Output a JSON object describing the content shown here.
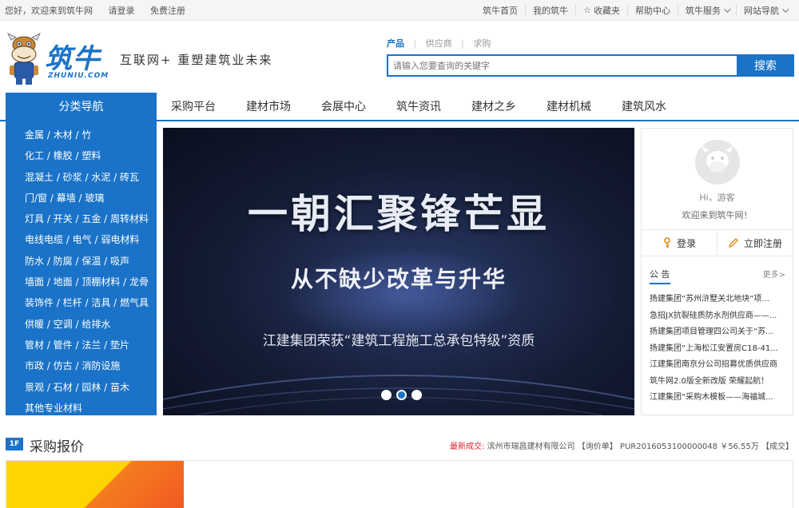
{
  "topbar": {
    "greeting": "您好，欢迎来到筑牛网",
    "login": "请登录",
    "register": "免费注册",
    "links": [
      "筑牛首页",
      "我的筑牛",
      "收藏夹",
      "帮助中心",
      "筑牛服务",
      "网站导航"
    ]
  },
  "header": {
    "brand": "筑牛",
    "domain": "ZHUNIU.COM",
    "slogan": "互联网+ 重塑建筑业未来"
  },
  "search": {
    "tabs": [
      "产品",
      "供应商",
      "求购"
    ],
    "placeholder": "请输入您要查询的关键字",
    "button": "搜索"
  },
  "nav": {
    "category_label": "分类导航",
    "items": [
      "采购平台",
      "建材市场",
      "会展中心",
      "筑牛资讯",
      "建材之乡",
      "建材机械",
      "建筑风水"
    ]
  },
  "categories": [
    "金属 / 木材 / 竹",
    "化工 / 橡胶 / 塑料",
    "混凝土 / 砂浆 / 水泥 / 砖瓦",
    "门/窗 / 幕墙 / 玻璃",
    "灯具 / 开关 / 五金 / 周转材料",
    "电线电缆 / 电气 / 弱电材料",
    "防水 / 防腐 / 保温 / 吸声",
    "墙面 / 地面 / 顶棚材料 / 龙骨",
    "装饰件 / 栏杆 / 洁具 / 燃气具",
    "供暖 / 空调 / 给排水",
    "管材 / 管件 / 法兰 / 垫片",
    "市政 / 仿古 / 消防设施",
    "景观 / 石材 / 园林 / 苗木",
    "其他专业材料"
  ],
  "banner": {
    "headline": "一朝汇聚锋芒显",
    "subheadline": "从不缺少改革与升华",
    "caption": "江建集团荣获“建筑工程施工总承包特级”资质",
    "slide_count": 3,
    "active_slide": 2
  },
  "user_panel": {
    "hi": "Hi，游客",
    "welcome": "欢迎来到筑牛网！",
    "login": "登录",
    "register": "立即注册",
    "notice_title": "公 告",
    "more": "更多>",
    "notices": [
      "扬建集团“苏州浒墅关北地块“项...",
      "急招JX抗裂硅质防水剂供应商——...",
      "扬建集团项目管理四公司关于“苏...",
      "扬建集团“上海松江安置房C18-41...",
      "江建集团南京分公司招募优质供应商",
      "筑牛网2.0版全新改版 荣耀起航！",
      "江建集团“采购木模板——海福城..."
    ]
  },
  "floor": {
    "badge": "1F",
    "title": "采购报价",
    "latest_label": "最新成交:",
    "latest_text": "滨州市瑞昌建材有限公司 【询价单】 PUR2016053100000048 ￥56.55万 【成交】"
  },
  "colors": {
    "primary": "#1a73c8",
    "accent_red": "#d9232d"
  }
}
